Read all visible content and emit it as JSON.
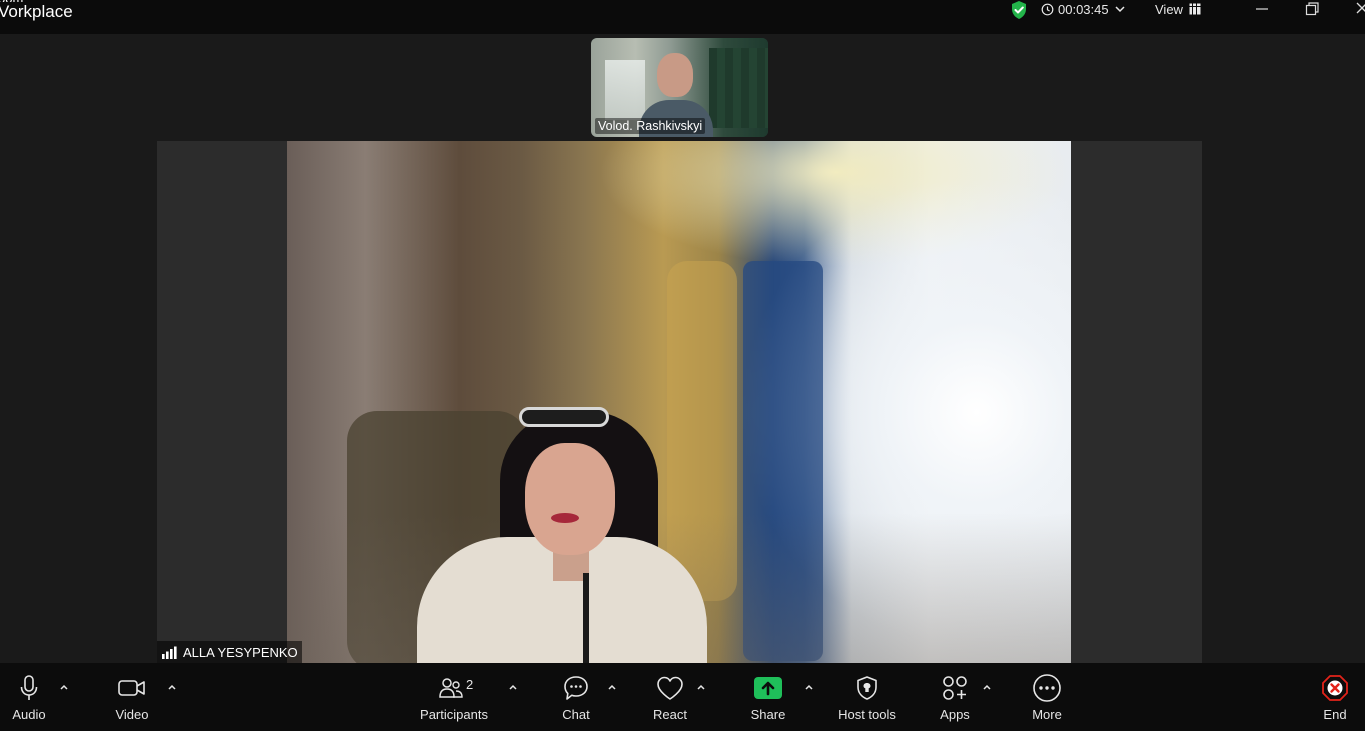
{
  "window": {
    "title_line1": "oom",
    "title_line2": "Vorkplace",
    "timer": "00:03:45",
    "view_label": "View"
  },
  "colors": {
    "secure_green": "#23b44a",
    "share_green": "#1fbf5a",
    "end_red": "#e2231a",
    "toolbar_bg": "#0c0c0c"
  },
  "thumbnail": {
    "participant_name": "Volod. Rashkivskyi"
  },
  "stage": {
    "speaker_name": "ALLA YESYPENKO"
  },
  "toolbar": {
    "audio": "Audio",
    "video": "Video",
    "participants": "Participants",
    "participants_count": "2",
    "chat": "Chat",
    "react": "React",
    "share": "Share",
    "host_tools": "Host tools",
    "apps": "Apps",
    "more": "More",
    "end": "End"
  },
  "icons": [
    "shield-check-icon",
    "clock-icon",
    "chevron-down-icon",
    "grid-icon",
    "minimize-icon",
    "restore-icon",
    "close-icon",
    "signal-icon",
    "microphone-icon",
    "video-camera-icon",
    "participants-icon",
    "chat-icon",
    "heart-icon",
    "share-arrow-icon",
    "host-shield-icon",
    "apps-icon",
    "more-dots-icon",
    "end-x-icon",
    "caret-up-icon"
  ]
}
